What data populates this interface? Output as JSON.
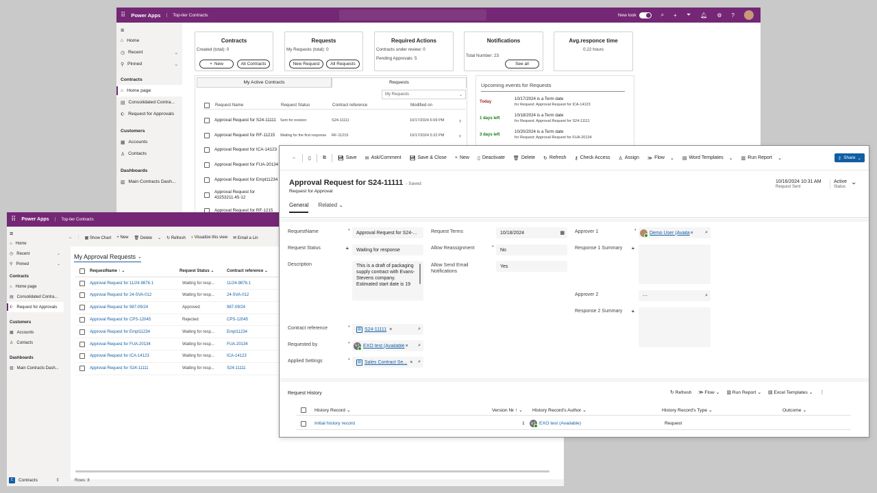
{
  "back_window": {
    "app_name": "Power Apps",
    "env_name": "Top-tier Contracts",
    "new_look": "New look",
    "nav": {
      "home": "Home",
      "recent": "Recent",
      "pinned": "Pinned",
      "contracts_section": "Contracts",
      "home_page": "Home page",
      "consolidated": "Consolidated Contra...",
      "req_approvals": "Request for Approvals",
      "customers_section": "Customers",
      "accounts": "Accounts",
      "contacts": "Contacts",
      "dashboards_section": "Dashboards",
      "main_dash": "Main Contracts Dash..."
    },
    "cards": {
      "contracts": {
        "title": "Contracts",
        "line1": "Created (total): 0",
        "btn1": "New",
        "btn2": "All Contracts"
      },
      "requests": {
        "title": "Requests",
        "line1": "My Requests (total): 0",
        "btn1": "New Request",
        "btn2": "All Requests"
      },
      "actions": {
        "title": "Required Actions",
        "line1": "Contracts under review: 0",
        "line2": "Pending Approvals: 5"
      },
      "notifications": {
        "title": "Notifications",
        "line1": "Total Number: 23",
        "btn1": "See all"
      },
      "avg": {
        "title": "Avg.responce time",
        "line1": "0.22 hours"
      }
    },
    "tabs": {
      "tab1": "My Active Contracts",
      "tab2": "Requests"
    },
    "view_select": "My Requests",
    "req_cols": {
      "name": "Request Name",
      "status": "Request Status",
      "ref": "Contract reference",
      "mod": "Modified on"
    },
    "req_rows": [
      {
        "name": "Approval Request for S24-11111",
        "status": "Sent for revision",
        "ref": "S24-11111",
        "mod": "10/17/2024 6:09 PM"
      },
      {
        "name": "Approval Request for RF-11215",
        "status": "Waiting for the first response",
        "ref": "RF-11215",
        "mod": "10/17/2024 5:22 PM"
      },
      {
        "name": "Approval Request for ICA-14123",
        "status": "",
        "ref": "",
        "mod": ""
      },
      {
        "name": "Approval Request for FUA-20134",
        "status": "",
        "ref": "",
        "mod": ""
      },
      {
        "name": "Approval Request for Empl11234",
        "status": "",
        "ref": "",
        "mod": ""
      },
      {
        "name": "Approval Request for 43253211.45-12",
        "status": "",
        "ref": "",
        "mod": ""
      },
      {
        "name": "Approval Request for RF-1215",
        "status": "",
        "ref": "",
        "mod": ""
      }
    ],
    "events": {
      "title": "Upcoming events for Requests",
      "items": [
        {
          "when": "Today",
          "title": "10/17/2024 is a Term date",
          "sub": "for Request: Approval Request for ICA-14123"
        },
        {
          "when": "1 days left",
          "title": "10/18/2024 is a Term date",
          "sub": "for Request: Approval Request for S24-11111"
        },
        {
          "when": "3 days left",
          "title": "10/20/2024 is a Term date",
          "sub": "for Request: Approval Request for FUA-20134"
        }
      ]
    }
  },
  "left_window": {
    "app_name": "Power Apps",
    "env_name": "Top-tier Contracts",
    "nav": {
      "home": "Home",
      "recent": "Recent",
      "pinned": "Pinned",
      "contracts_section": "Contracts",
      "home_page": "Home page",
      "consolidated": "Consolidated Contra...",
      "req_approvals": "Request for Approvals",
      "customers_section": "Customers",
      "accounts": "Accounts",
      "contacts": "Contacts",
      "dashboards_section": "Dashboards",
      "main_dash": "Main Contracts Dash...",
      "area": "Contracts"
    },
    "cmd": {
      "show_chart": "Show Chart",
      "new": "New",
      "delete": "Delete",
      "refresh": "Refresh",
      "visualize": "Visualize this view",
      "email": "Email a Lin"
    },
    "view_title": "My Approval Requests",
    "cols": {
      "name": "RequestName ↑",
      "status": "Request Status",
      "ref": "Contract reference"
    },
    "rows": [
      {
        "name": "Approval Request for 11/24-9876.1",
        "status": "Waiting for resp...",
        "ref": "11/24-9876.1"
      },
      {
        "name": "Approval Request for 24-SVA-012",
        "status": "Waiting for resp...",
        "ref": "24-SVA-012"
      },
      {
        "name": "Approval Request for 987-09/24",
        "status": "Approved",
        "ref": "987-09/24"
      },
      {
        "name": "Approval Request for CPS-12045",
        "status": "Rejected",
        "ref": "CPS-12045"
      },
      {
        "name": "Approval Request for Empl11234",
        "status": "Waiting for resp...",
        "ref": "Empl11234"
      },
      {
        "name": "Approval Request for FUA-20134",
        "status": "Waiting for resp...",
        "ref": "FUA-20134"
      },
      {
        "name": "Approval Request for ICA-14123",
        "status": "Waiting for resp...",
        "ref": "ICA-14123"
      },
      {
        "name": "Approval Request for S24-11111",
        "status": "Waiting for resp...",
        "ref": "S24-11111"
      }
    ],
    "rows_count": "Rows: 8"
  },
  "form": {
    "cmd": {
      "save": "Save",
      "ask": "Ask/Comment",
      "save_close": "Save & Close",
      "new": "New",
      "deactivate": "Deactivate",
      "delete": "Delete",
      "refresh": "Refresh",
      "check_access": "Check Access",
      "assign": "Assign",
      "flow": "Flow",
      "word": "Word Templates",
      "run_report": "Run Report",
      "share": "Share"
    },
    "title": "Approval Request for S24-11111",
    "saved": "- Saved",
    "entity": "Request for Approval",
    "header_date": "10/16/2024 10:31 AM",
    "header_date_label": "Request Sent",
    "header_status": "Active",
    "header_status_label": "Status",
    "tab_general": "General",
    "tab_related": "Related",
    "fields": {
      "request_name_label": "RequestName",
      "request_name": "Approval Request for S24-...",
      "request_status_label": "Request Status",
      "request_status": "Waiting for response",
      "description_label": "Description",
      "description": "This is a draft of packaging supply contract with Evans-Stevens company. Estimated start date is 19",
      "contract_ref_label": "Contract reference",
      "contract_ref": "S24-11111",
      "requested_by_label": "Requested by",
      "requested_by": "EXO test (Available",
      "applied_label": "Applied Settings",
      "applied": "Sales Contract Se...",
      "terms_label": "Request Terms",
      "terms": "10/18/2024",
      "reassign_label": "Allow Reassignment",
      "reassign": "No",
      "send_email_label": "Allow Send Email Notifications",
      "send_email": "Yes",
      "approver1_label": "Approver 1",
      "approver1": "Demo User (Availa",
      "resp1_label": "Response 1 Summary",
      "approver2_label": "Approver 2",
      "approver2": "---",
      "resp2_label": "Response 2 Summary"
    },
    "history": {
      "title": "Request History",
      "refresh": "Refresh",
      "flow": "Flow",
      "run_report": "Run Report",
      "excel": "Excel Templates",
      "cols": {
        "record": "History Record",
        "version": "Version № ↑",
        "author": "History Record's Author",
        "type": "History Record's Type",
        "outcome": "Outcome"
      },
      "rows": [
        {
          "record": "Initial history record",
          "version": "1",
          "author": "EXO test (Available)",
          "type": "Request",
          "outcome": ""
        }
      ]
    }
  }
}
